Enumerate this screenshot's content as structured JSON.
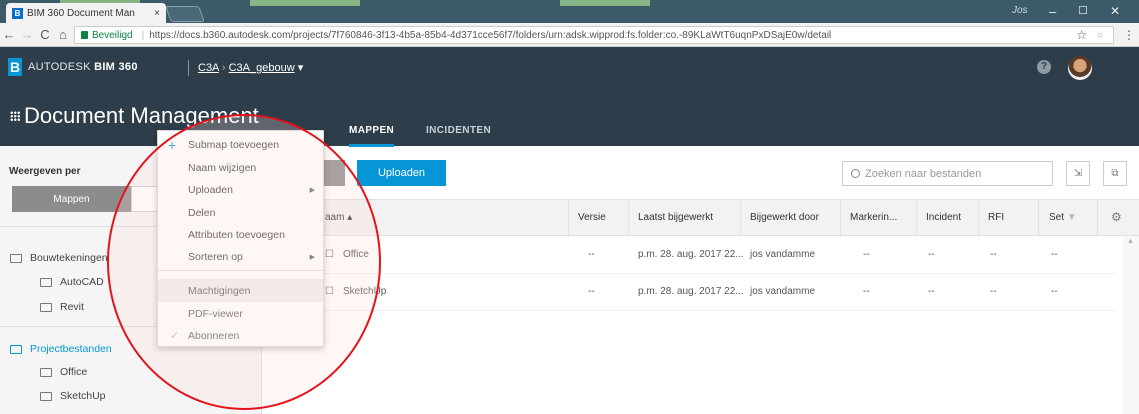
{
  "browser": {
    "tab_title": "BIM 360 Document Man",
    "tab_close": "×",
    "user_badge": "Jos",
    "window_controls": [
      "–",
      "☐",
      "✕"
    ],
    "secure_label": "Beveiligd",
    "url": "https://docs.b360.autodesk.com/projects/7f760846-3f13-4b5a-85b4-4d371cce56f7/folders/urn:adsk.wipprod:fs.folder:co.-89KLaWtT6uqnPxDSajE0w/detail"
  },
  "app": {
    "brand_prefix": "AUTODESK",
    "brand_name": "BIM 360",
    "breadcrumb_project": "C3A",
    "breadcrumb_sep": "›",
    "breadcrumb_current": "C3A_gebouw",
    "help": "?",
    "module_title": "Document Management",
    "tabs": [
      "MAPPEN",
      "INCIDENTEN"
    ]
  },
  "sidebar": {
    "heading": "Weergeven per",
    "segment_active": "Mappen",
    "tree": [
      {
        "label": "Bouwtekeningen",
        "level": 0,
        "selected": false
      },
      {
        "label": "AutoCAD",
        "level": 1,
        "selected": false
      },
      {
        "label": "Revit",
        "level": 1,
        "selected": false
      },
      {
        "label": "Projectbestanden",
        "level": 0,
        "selected": true
      },
      {
        "label": "Office",
        "level": 1,
        "selected": false
      },
      {
        "label": "SketchUp",
        "level": 1,
        "selected": false
      }
    ]
  },
  "toolbar": {
    "upload_label": "Uploaden",
    "search_placeholder": "Zoeken naar bestanden"
  },
  "table": {
    "columns": [
      "aam",
      "Versie",
      "Laatst bijgewerkt",
      "Bijgewerkt door",
      "Markerin...",
      "Incident",
      "RFI",
      "Set"
    ],
    "rows": [
      {
        "name": "Office",
        "version": "--",
        "updated": "p.m. 28. aug. 2017 22...",
        "by": "jos vandamme",
        "markup": "--",
        "incident": "--",
        "rfi": "--",
        "set": "--"
      },
      {
        "name": "SketchUp",
        "version": "--",
        "updated": "p.m. 28. aug. 2017 22...",
        "by": "jos vandamme",
        "markup": "--",
        "incident": "--",
        "rfi": "--",
        "set": "--"
      }
    ]
  },
  "context_menu": {
    "items": [
      "Submap toevoegen",
      "Naam wijzigen",
      "Uploaden",
      "Delen",
      "Attributen toevoegen",
      "Sorteren op",
      "Machtigingen",
      "PDF-viewer",
      "Abonneren"
    ]
  },
  "colors": {
    "accent": "#0696d7",
    "header_bg": "#2d3e4a",
    "annotation": "#e3131b"
  }
}
